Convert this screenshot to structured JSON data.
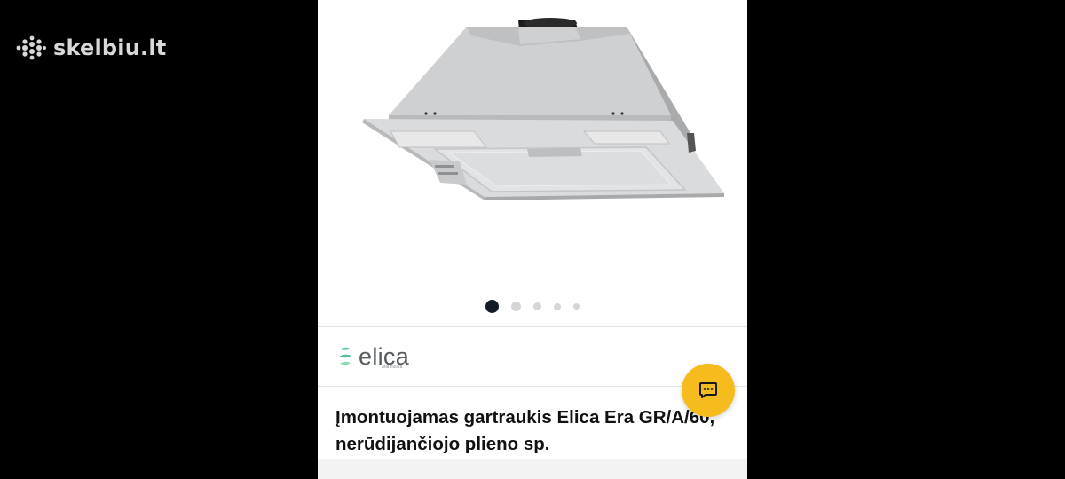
{
  "watermark": {
    "brand": "skelbiu.lt",
    "icon": "dots-logo-icon"
  },
  "gallery": {
    "image_subject": "range-hood-image",
    "slide_count": 5,
    "active_slide": 1
  },
  "brand": {
    "name": "elica",
    "tagline": "aria nuova",
    "icon": "elica-leaf-icon",
    "accent": "#5bc9a0"
  },
  "chat": {
    "icon": "chat-bubble-icon",
    "color": "#f6bb1d"
  },
  "listing": {
    "title": "Įmontuojamas gartraukis Elica Era GR/A/60, nerūdijančiojo plieno sp."
  }
}
